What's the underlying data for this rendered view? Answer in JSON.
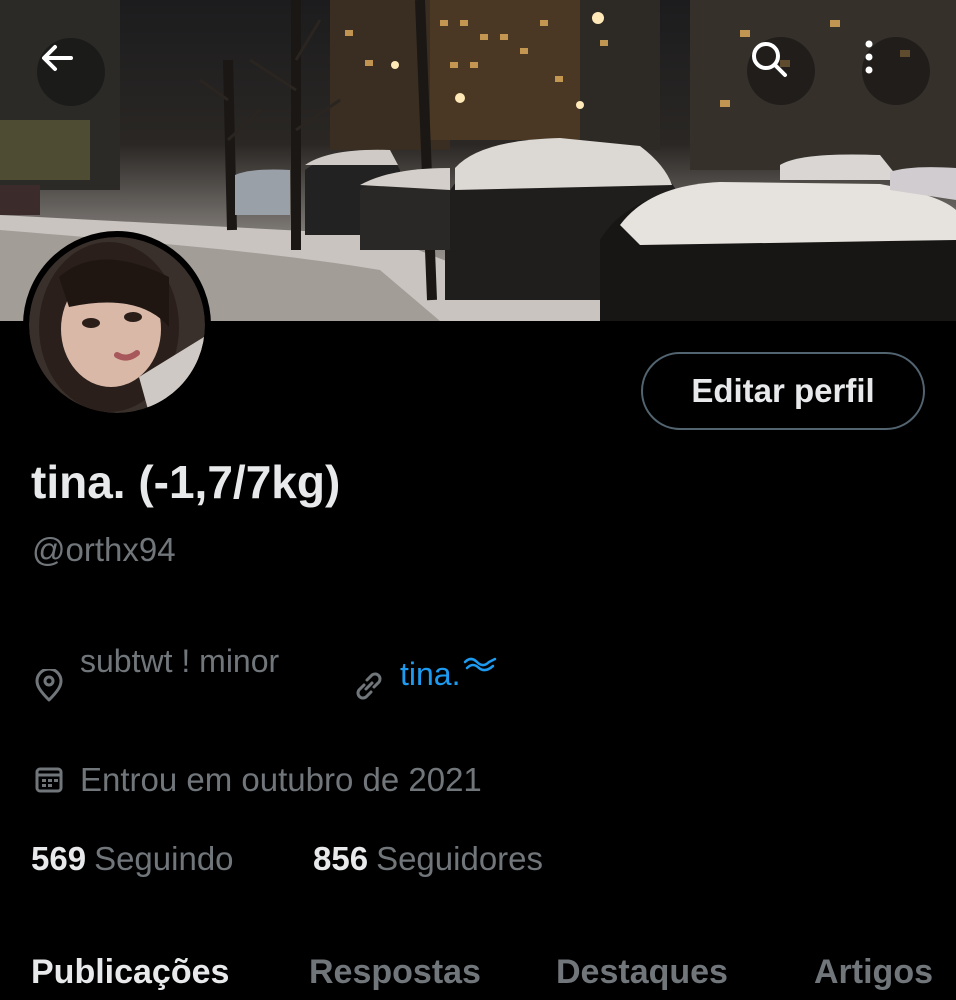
{
  "header": {
    "back_icon": "arrow-left-icon",
    "search_icon": "search-icon",
    "more_icon": "more-vertical-icon"
  },
  "profile": {
    "display_name": "tina. (-1,7/7kg)",
    "handle": "@orthx94",
    "edit_button_label": "Editar perfil",
    "location": "subtwt ! minor",
    "link_text": "tina.",
    "joined": "Entrou em outubro de 2021"
  },
  "stats": {
    "following_count": "569",
    "following_label": "Seguindo",
    "followers_count": "856",
    "followers_label": "Seguidores"
  },
  "tabs": [
    {
      "label": "Publicações",
      "active": true
    },
    {
      "label": "Respostas",
      "active": false
    },
    {
      "label": "Destaques",
      "active": false
    },
    {
      "label": "Artigos",
      "active": false
    }
  ],
  "colors": {
    "background": "#000000",
    "text_primary": "#e7e9ea",
    "text_secondary": "#71767b",
    "link": "#1d9bf0",
    "button_border": "#536471"
  }
}
